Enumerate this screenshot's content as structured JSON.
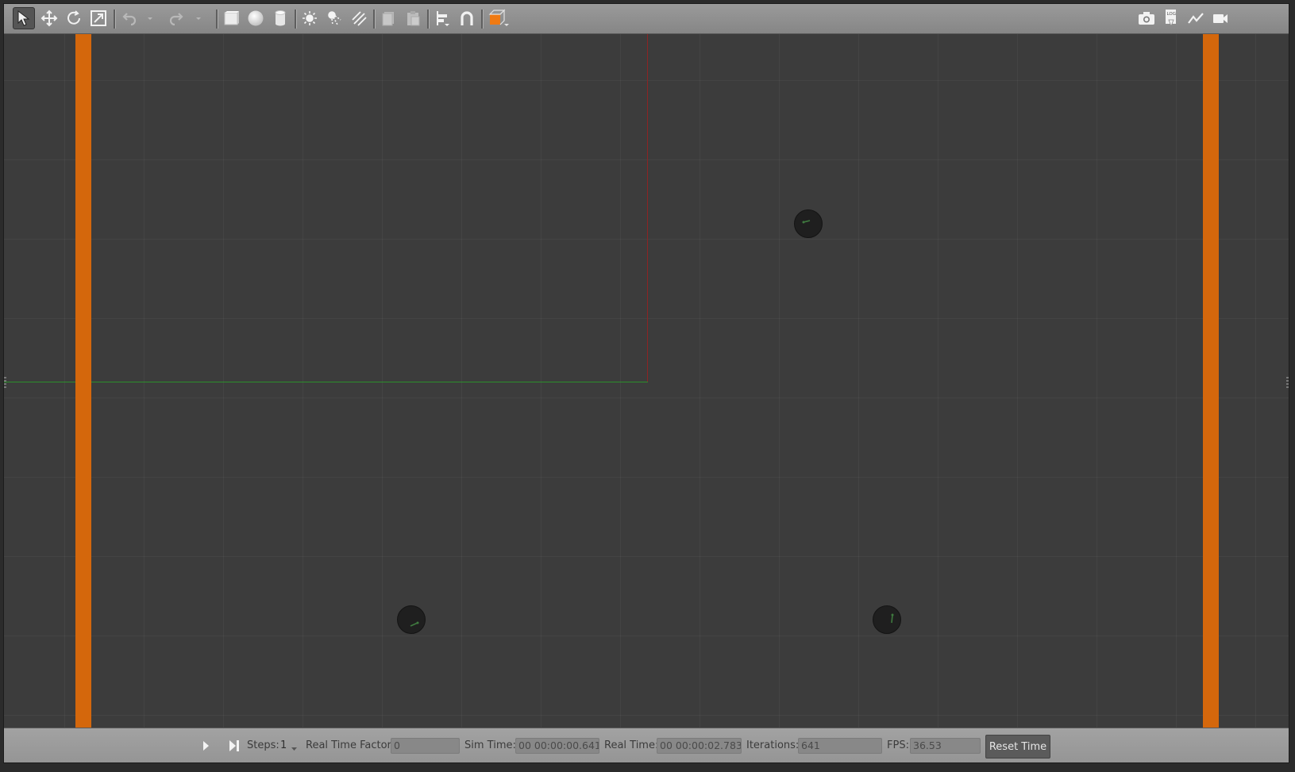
{
  "toolbar": {
    "left_tools": [
      {
        "name": "select-mode-icon",
        "active": true
      },
      {
        "name": "translate-mode-icon"
      },
      {
        "name": "rotate-mode-icon"
      },
      {
        "name": "scale-mode-icon"
      },
      {
        "name": "undo-icon"
      },
      {
        "name": "undo-history-dropdown-icon"
      },
      {
        "name": "redo-icon"
      },
      {
        "name": "redo-history-dropdown-icon"
      },
      {
        "name": "box-shape-icon"
      },
      {
        "name": "sphere-shape-icon"
      },
      {
        "name": "cylinder-shape-icon"
      },
      {
        "name": "point-light-icon"
      },
      {
        "name": "spot-light-icon"
      },
      {
        "name": "directional-light-icon"
      },
      {
        "name": "copy-icon"
      },
      {
        "name": "paste-icon"
      },
      {
        "name": "align-icon"
      },
      {
        "name": "snap-magnet-icon"
      },
      {
        "name": "view-angle-icon"
      }
    ],
    "right_tools": [
      {
        "name": "screenshot-camera-icon"
      },
      {
        "name": "log-icon",
        "label": "LOG"
      },
      {
        "name": "plot-icon"
      },
      {
        "name": "video-record-icon"
      }
    ]
  },
  "viewport": {
    "wall_color": "#d4670c",
    "x_axis_color": "#2c8f2c",
    "y_axis_color": "#8c2424",
    "robot_count": 3
  },
  "bottombar": {
    "steps_label": "Steps:",
    "steps_value": "1",
    "rtf_label": "Real Time Factor:",
    "rtf_value": "0",
    "sim_time_label": "Sim Time:",
    "sim_time_value": "00 00:00:00.641",
    "real_time_label": "Real Time:",
    "real_time_value": "00 00:00:02.783",
    "iterations_label": "Iterations:",
    "iterations_value": "641",
    "fps_label": "FPS:",
    "fps_value": "36.53",
    "reset_label": "Reset Time"
  }
}
